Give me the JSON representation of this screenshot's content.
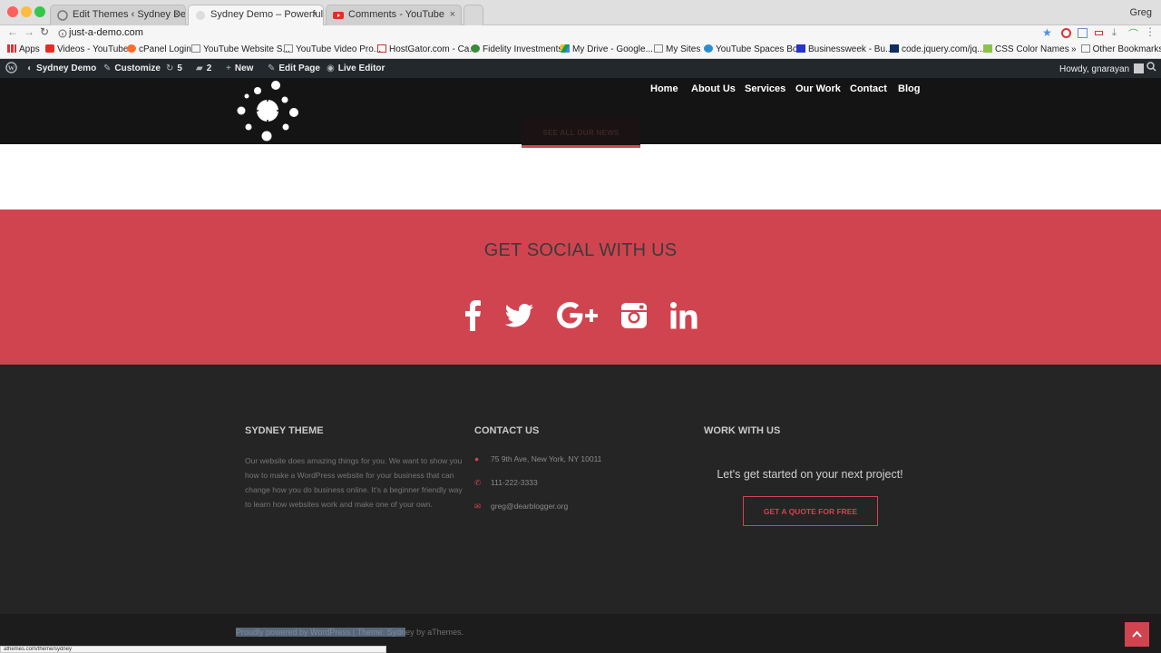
{
  "browser": {
    "tabs": [
      {
        "title": "Edit Themes ‹ Sydney Demo —",
        "active": false
      },
      {
        "title": "Sydney Demo – Powerful busi",
        "active": true
      },
      {
        "title": "Comments - YouTube",
        "active": false
      }
    ],
    "profile_name": "Greg",
    "url": "just-a-demo.com",
    "bookmarks": [
      "Apps",
      "Videos - YouTube",
      "cPanel Login",
      "YouTube Website S...",
      "YouTube Video Pro...",
      "HostGator.com - Ca...",
      "Fidelity Investments",
      "My Drive - Google...",
      "My Sites",
      "YouTube Spaces Bo...",
      "Businessweek - Bu...",
      "code.jquery.com/jq...",
      "CSS Color Names",
      "Other Bookmarks"
    ],
    "status_url": "athemes.com/theme/sydney"
  },
  "adminbar": {
    "site_name": "Sydney Demo",
    "customize": "Customize",
    "updates_count": "5",
    "comments_count": "2",
    "new": "New",
    "edit_page": "Edit Page",
    "live_editor": "Live Editor",
    "howdy": "Howdy, gnarayan"
  },
  "header": {
    "nav": [
      "Home",
      "About Us",
      "Services",
      "Our Work",
      "Contact",
      "Blog"
    ],
    "see_news_button": "SEE ALL OUR NEWS"
  },
  "social": {
    "title": "GET SOCIAL WITH US",
    "icons": [
      "facebook-icon",
      "twitter-icon",
      "google-plus-icon",
      "instagram-icon",
      "linkedin-icon"
    ]
  },
  "footer": {
    "about": {
      "heading": "SYDNEY THEME",
      "text": "Our website does amazing things for you. We want to show you how to make a WordPress website for your business that can change how you do business online. It's a beginner friendly way to learn how websites work and make one of your own."
    },
    "contact": {
      "heading": "CONTACT US",
      "address": "75 9th Ave, New York, NY 10011",
      "phone": "111-222-3333",
      "email": "greg@dearblogger.org"
    },
    "work": {
      "heading": "WORK WITH US",
      "cta": "Let's get started on your next project!",
      "button": "GET A QUOTE FOR FREE"
    },
    "credit_selected": "Proudly powered by WordPress | Theme: Sydn",
    "credit_rest": "ey by aThemes."
  },
  "colors": {
    "accent": "#d0444f",
    "header_bg": "#141414",
    "footer_bg": "#252525",
    "adminbar_bg": "#23282d"
  }
}
